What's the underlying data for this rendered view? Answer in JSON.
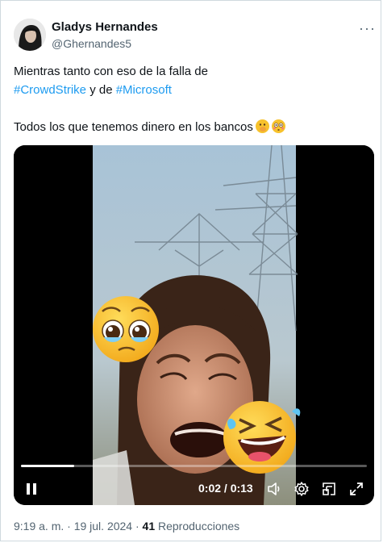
{
  "post": {
    "author_name": "Gladys Hernandes",
    "author_handle": "@Ghernandes5",
    "more_label": "···",
    "text_line1": "Mientras tanto con eso de la falla de",
    "hashtag1": "#CrowdStrike",
    "text_connector": " y de ",
    "hashtag2": "#Microsoft",
    "text_line3": "Todos los que tenemos dinero en los bancos",
    "emojis": [
      "face-with-hand-over-mouth",
      "flushed-face"
    ]
  },
  "video": {
    "time_display": "0:02 / 0:13",
    "progress": 0.154,
    "state": "playing",
    "controls": [
      "pause-icon",
      "volume-icon",
      "settings-icon",
      "minimize-icon",
      "fullscreen-icon"
    ]
  },
  "footer": {
    "timestamp": "9:19 a. m. · 19 jul. 2024 · ",
    "views_count": "41",
    "views_label": " Reproducciones"
  },
  "colors": {
    "accent": "#1d9bf0",
    "text_primary": "#0f1419",
    "text_secondary": "#536471"
  }
}
